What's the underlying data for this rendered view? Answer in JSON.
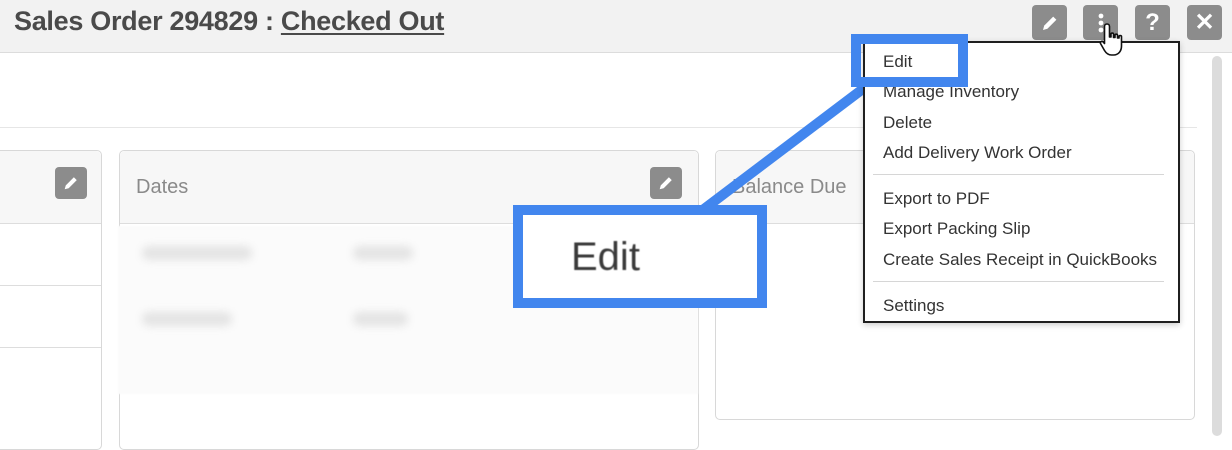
{
  "header": {
    "title": "Sales Order 294829 : ",
    "status": "Checked Out",
    "buttons": [
      {
        "name": "edit-button",
        "icon": "pencil-icon"
      },
      {
        "name": "more-actions-button",
        "icon": "vertical-ellipsis-icon"
      },
      {
        "name": "help-button",
        "icon": "question-icon"
      },
      {
        "name": "close-button",
        "icon": "close-icon"
      }
    ]
  },
  "panels": {
    "dates": {
      "title": "Dates"
    },
    "balance": {
      "title": "Balance Due"
    }
  },
  "dropdown": {
    "items": [
      "Edit",
      "Manage Inventory",
      "Delete",
      "Add Delivery Work Order",
      "Export to PDF",
      "Export Packing Slip",
      "Create Sales Receipt in QuickBooks",
      "Settings"
    ]
  },
  "callout": {
    "text": "Edit"
  },
  "colors": {
    "accent": "#4286ee",
    "button": "#8c8c8c",
    "header_bg": "#f2f2f2"
  }
}
